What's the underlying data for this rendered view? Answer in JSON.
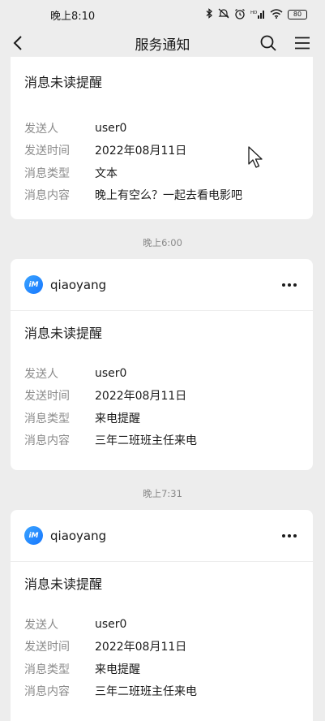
{
  "status_bar": {
    "time": "晚上8:10",
    "icons": [
      "bluetooth-icon",
      "mute-icon",
      "alarm-icon",
      "signal-icon",
      "wifi-icon"
    ],
    "signal_text": "HD",
    "battery": "80"
  },
  "nav": {
    "title": "服务通知",
    "back_icon": "back-arrow-icon",
    "search_icon": "search-icon",
    "menu_icon": "menu-icon"
  },
  "field_labels": {
    "sender": "发送人",
    "send_time": "发送时间",
    "msg_type": "消息类型",
    "msg_content": "消息内容"
  },
  "messages": [
    {
      "title": "消息未读提醒",
      "sender": "user0",
      "send_time": "2022年08月11日",
      "msg_type": "文本",
      "msg_content": "晚上有空么？一起去看电影吧"
    },
    {
      "timestamp": "晚上6:00",
      "app_name": "qiaoyang",
      "app_icon_text": "iM",
      "title": "消息未读提醒",
      "sender": "user0",
      "send_time": "2022年08月11日",
      "msg_type": "来电提醒",
      "msg_content": "三年二班班主任来电"
    },
    {
      "timestamp": "晚上7:31",
      "app_name": "qiaoyang",
      "app_icon_text": "iM",
      "title": "消息未读提醒",
      "sender": "user0",
      "send_time": "2022年08月11日",
      "msg_type": "来电提醒",
      "msg_content": "三年二班班主任来电"
    }
  ]
}
